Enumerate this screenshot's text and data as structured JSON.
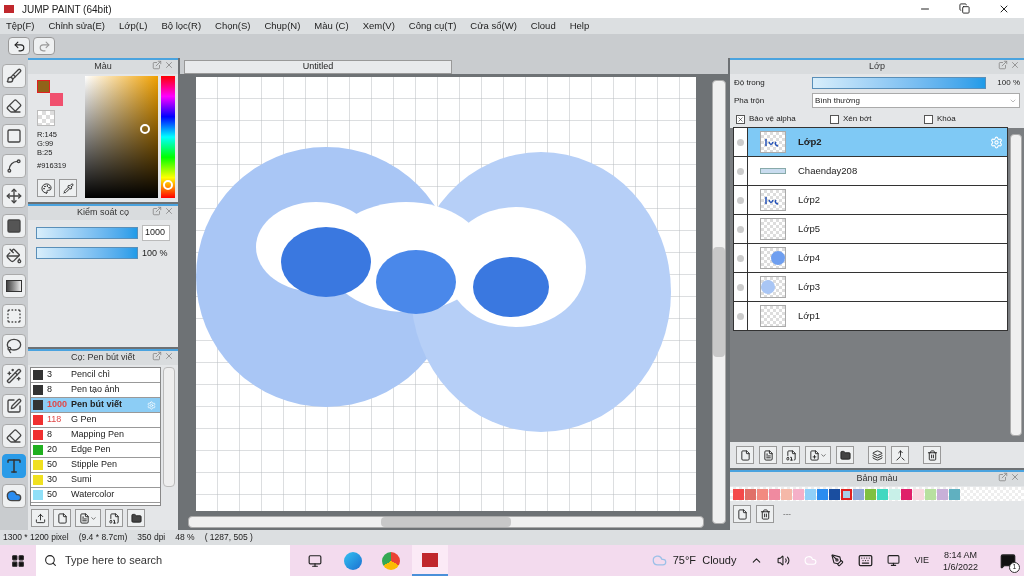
{
  "window": {
    "title": "JUMP PAINT (64bit)"
  },
  "menu": [
    "Tệp(F)",
    "Chỉnh sửa(E)",
    "Lớp(L)",
    "Bộ lọc(R)",
    "Chọn(S)",
    "Chụp(N)",
    "Màu (C)",
    "Xem(V)",
    "Công cụ(T)",
    "Cửa sổ(W)",
    "Cloud",
    "Help"
  ],
  "tools": [
    {
      "kind": "brush",
      "selected": false
    },
    {
      "kind": "eraser",
      "selected": false
    },
    {
      "kind": "rect",
      "selected": false
    },
    {
      "kind": "dotline",
      "selected": false
    },
    {
      "kind": "move",
      "selected": false
    },
    {
      "kind": "fill",
      "selected": false
    },
    {
      "kind": "bucket",
      "selected": false
    },
    {
      "kind": "gradient",
      "selected": false
    },
    {
      "kind": "select",
      "selected": false
    },
    {
      "kind": "lasso",
      "selected": false
    },
    {
      "kind": "wand",
      "selected": false
    },
    {
      "kind": "selpen",
      "selected": false
    },
    {
      "kind": "selerase",
      "selected": false
    },
    {
      "kind": "text",
      "selected": true
    },
    {
      "kind": "cloud",
      "selected": false
    }
  ],
  "color_panel": {
    "title": "Màu",
    "foreground": {
      "color": "#916319"
    },
    "background": {
      "color": "#f0506e"
    },
    "rgb": [
      "R:145",
      "G:99",
      "B:25"
    ],
    "hex": "#916319"
  },
  "brush_control": {
    "title": "Kiểm soát cọ",
    "size": {
      "level": 1,
      "value": "1000"
    },
    "opacity": {
      "level": 1,
      "reading": "100 %"
    }
  },
  "brushes": {
    "title": "Cọ: Pen bút viết",
    "items": [
      {
        "size": "3",
        "name": "Pencil chì",
        "color": "#333333",
        "selected": false,
        "accent": false
      },
      {
        "size": "8",
        "name": "Pen tạo ảnh",
        "color": "#333333",
        "selected": false,
        "accent": false
      },
      {
        "size": "1000",
        "name": "Pen bút viết",
        "color": "#333333",
        "selected": true,
        "accent": true
      },
      {
        "size": "118",
        "name": "G Pen",
        "color": "#f03030",
        "selected": false,
        "accent": true
      },
      {
        "size": "8",
        "name": "Mapping Pen",
        "color": "#f03030",
        "selected": false,
        "accent": false
      },
      {
        "size": "20",
        "name": "Edge Pen",
        "color": "#20b020",
        "selected": false,
        "accent": false
      },
      {
        "size": "50",
        "name": "Stipple Pen",
        "color": "#f0e020",
        "selected": false,
        "accent": false
      },
      {
        "size": "30",
        "name": "Sumi",
        "color": "#f0e020",
        "selected": false,
        "accent": false
      },
      {
        "size": "50",
        "name": "Watercolor",
        "color": "#90e0f8",
        "selected": false,
        "accent": false
      }
    ]
  },
  "canvas": {
    "tab": "Untitled",
    "kind": "picture"
  },
  "layers_panel": {
    "title": "Lớp",
    "opacity": {
      "label": "Độ trong",
      "level": 1,
      "reading": "100 %"
    },
    "blend": {
      "label": "Pha trộn",
      "value": "Bình thường"
    },
    "options": [
      {
        "label": "Bảo vệ alpha",
        "checked": true
      },
      {
        "label": "Xén bớt",
        "checked": false
      },
      {
        "label": "Khóa",
        "checked": false
      }
    ],
    "layers": [
      {
        "name": "Lớp2",
        "selected": true,
        "kind": "lettering"
      },
      {
        "name": "Chaenday208",
        "selected": false,
        "kind": "strip"
      },
      {
        "name": "Lớp2",
        "selected": false,
        "kind": "lettering"
      },
      {
        "name": "Lớp5",
        "selected": false,
        "kind": "empty"
      },
      {
        "name": "Lớp4",
        "selected": false,
        "kind": "circle_right"
      },
      {
        "name": "Lớp3",
        "selected": false,
        "kind": "circle_left"
      },
      {
        "name": "Lớp1",
        "selected": false,
        "kind": "empty"
      }
    ]
  },
  "palette": {
    "title": "Bảng màu",
    "footer": "---",
    "colors": [
      {
        "color": "#f44a4a",
        "selected": false
      },
      {
        "color": "#e07068",
        "selected": false
      },
      {
        "color": "#f28a80",
        "selected": false
      },
      {
        "color": "#f08aa0",
        "selected": false
      },
      {
        "color": "#f5b8a8",
        "selected": false
      },
      {
        "color": "#f5b0c8",
        "selected": false
      },
      {
        "color": "#90d0f8",
        "selected": false
      },
      {
        "color": "#2a8cf0",
        "selected": false
      },
      {
        "color": "#1a4ea0",
        "selected": false
      },
      {
        "color": "#a8d0e8",
        "selected": true
      },
      {
        "color": "#90a8d8",
        "selected": false
      },
      {
        "color": "#80c040",
        "selected": false
      },
      {
        "color": "#40d8c0",
        "selected": false
      },
      {
        "color": "#c8f0e8",
        "selected": false
      },
      {
        "color": "#e0206a",
        "selected": false
      },
      {
        "color": "#f8d8e0",
        "selected": false
      },
      {
        "color": "#b8e0a0",
        "selected": false
      },
      {
        "color": "#c8b0d8",
        "selected": false
      },
      {
        "color": "#60b0c0",
        "selected": false
      }
    ]
  },
  "status_bar": {
    "size": "1300 * 1200 pixel",
    "physical": "(9.4 * 8.7cm)",
    "dpi": "350 dpi",
    "zoom": "48 %",
    "cursor": "( 1287, 505 )"
  },
  "taskbar": {
    "search_placeholder": "Type here to search",
    "weather": "75°F  Cloudy",
    "language": "VIE",
    "time": "8:14 AM",
    "date": "1/6/2022",
    "notifications": "1"
  }
}
